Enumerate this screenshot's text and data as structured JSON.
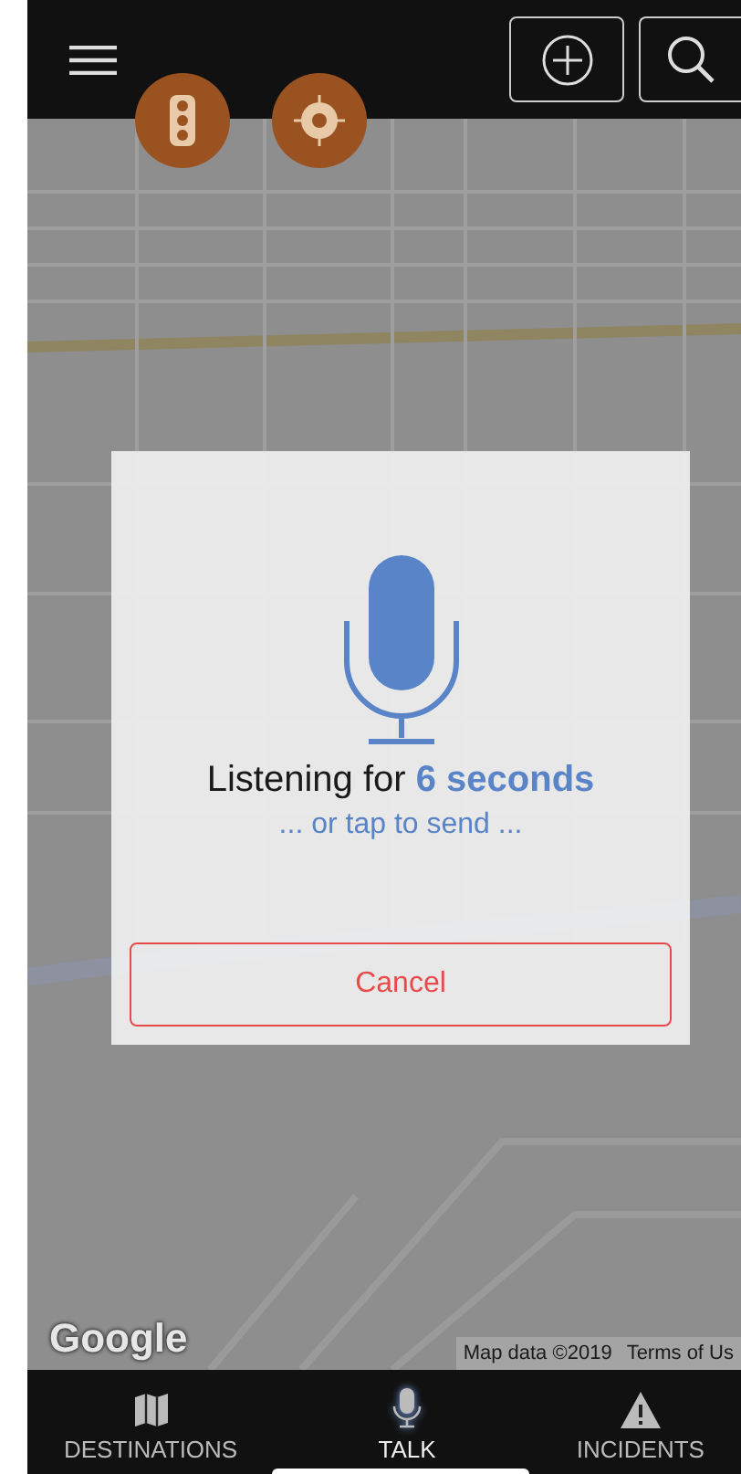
{
  "map": {
    "logo": "Google",
    "attribution": "Map data ©2019",
    "terms": "Terms of Us"
  },
  "dialog": {
    "title": "Listening for **6 seconds**",
    "subtitle": "... or tap to send ...",
    "cancel": "Cancel"
  },
  "tabs": [
    {
      "label": "DESTINATIONS",
      "kind": "map",
      "selected": false
    },
    {
      "label": "TALK",
      "kind": "mic",
      "selected": true
    },
    {
      "label": "INCIDENTS",
      "kind": "warning",
      "selected": false
    }
  ]
}
